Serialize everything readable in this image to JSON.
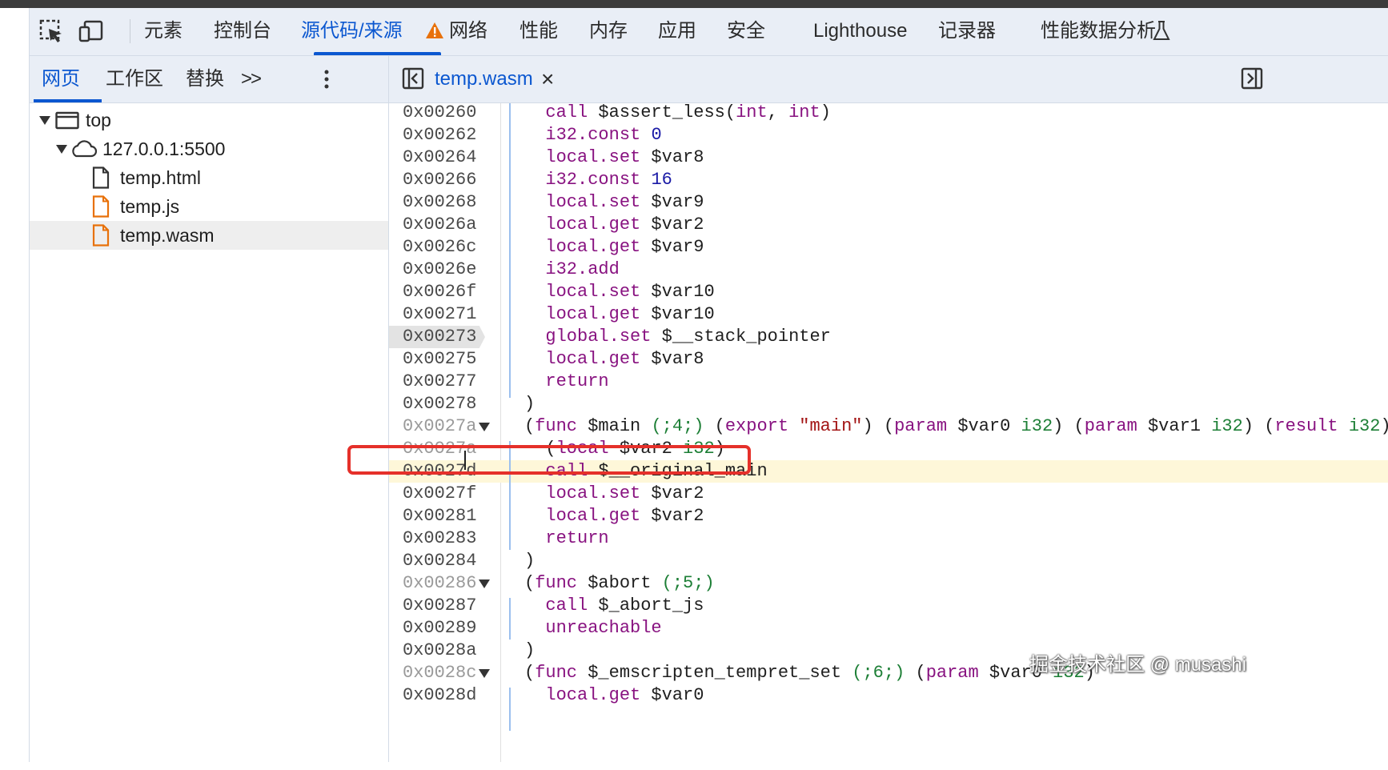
{
  "main_tabs": [
    {
      "label": "元素"
    },
    {
      "label": "控制台"
    },
    {
      "label": "源代码/来源",
      "active": true
    },
    {
      "label": "网络",
      "warning": true
    },
    {
      "label": "性能"
    },
    {
      "label": "内存"
    },
    {
      "label": "应用"
    },
    {
      "label": "安全"
    },
    {
      "label": "Lighthouse"
    },
    {
      "label": "记录器"
    },
    {
      "label": "性能数据分析"
    }
  ],
  "sources_tabs": [
    {
      "label": "网页",
      "active": true
    },
    {
      "label": "工作区"
    },
    {
      "label": "替换"
    }
  ],
  "more_tabs_label": ">>",
  "editor": {
    "open_file": "temp.wasm",
    "close_label": "×"
  },
  "tree": {
    "top": "top",
    "origin": "127.0.0.1:5500",
    "files": [
      {
        "name": "temp.html",
        "type": "html"
      },
      {
        "name": "temp.js",
        "type": "js"
      },
      {
        "name": "temp.wasm",
        "type": "wasm",
        "selected": true
      }
    ]
  },
  "code_lines": [
    {
      "addr": "0x00260",
      "text": "  call $assert_less(int, int)"
    },
    {
      "addr": "0x00262",
      "text": "  i32.const 0"
    },
    {
      "addr": "0x00264",
      "text": "  local.set $var8"
    },
    {
      "addr": "0x00266",
      "text": "  i32.const 16"
    },
    {
      "addr": "0x00268",
      "text": "  local.set $var9"
    },
    {
      "addr": "0x0026a",
      "text": "  local.get $var2"
    },
    {
      "addr": "0x0026c",
      "text": "  local.get $var9"
    },
    {
      "addr": "0x0026e",
      "text": "  i32.add"
    },
    {
      "addr": "0x0026f",
      "text": "  local.set $var10"
    },
    {
      "addr": "0x00271",
      "text": "  local.get $var10"
    },
    {
      "addr": "0x00273",
      "text": "  global.set $__stack_pointer"
    },
    {
      "addr": "0x00275",
      "text": "  local.get $var8"
    },
    {
      "addr": "0x00277",
      "text": "  return"
    },
    {
      "addr": "0x00278",
      "text": ")"
    },
    {
      "addr": "0x0027a",
      "text": "(func $main (;4;) (export \"main\") (param $var0 i32) (param $var1 i32) (result i32)"
    },
    {
      "addr": "0x0027a",
      "text": "  (local $var2 i32)"
    },
    {
      "addr": "0x0027d",
      "text": "  call $__original_main"
    },
    {
      "addr": "0x0027f",
      "text": "  local.set $var2"
    },
    {
      "addr": "0x00281",
      "text": "  local.get $var2"
    },
    {
      "addr": "0x00283",
      "text": "  return"
    },
    {
      "addr": "0x00284",
      "text": ")"
    },
    {
      "addr": "0x00286",
      "text": "(func $abort (;5;)"
    },
    {
      "addr": "0x00287",
      "text": "  call $_abort_js"
    },
    {
      "addr": "0x00289",
      "text": "  unreachable"
    },
    {
      "addr": "0x0028a",
      "text": ")"
    },
    {
      "addr": "0x0028c",
      "text": "(func $_emscripten_tempret_set (;6;) (param $var0 i32)"
    },
    {
      "addr": "0x0028d",
      "text": "  local.get $var0"
    }
  ],
  "watermark": "掘金技术社区 @ musashi",
  "colors": {
    "accent": "#0b57d0",
    "highlight_box": "#e5302a",
    "current_line": "#fef7d9",
    "warning": "#e8710a"
  }
}
